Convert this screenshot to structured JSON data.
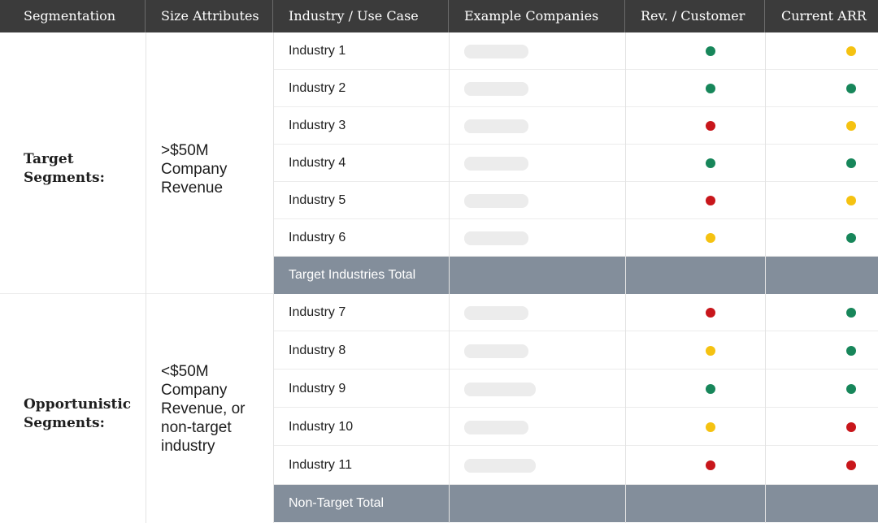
{
  "colors": {
    "green": "#17865a",
    "yellow": "#f5c211",
    "red": "#c8161b"
  },
  "headers": [
    "Segmentation",
    "Size Attributes",
    "Industry / Use Case",
    "Example Companies",
    "Rev. / Customer",
    "Current ARR"
  ],
  "groups": [
    {
      "segment": "Target Segments:",
      "size": ">$50M Company Revenue",
      "rows": [
        {
          "industry": "Industry 1",
          "rev": "green",
          "arr": "yellow"
        },
        {
          "industry": "Industry 2",
          "rev": "green",
          "arr": "green"
        },
        {
          "industry": "Industry 3",
          "rev": "red",
          "arr": "yellow"
        },
        {
          "industry": "Industry 4",
          "rev": "green",
          "arr": "green"
        },
        {
          "industry": "Industry 5",
          "rev": "red",
          "arr": "yellow"
        },
        {
          "industry": "Industry 6",
          "rev": "yellow",
          "arr": "green"
        }
      ],
      "total": "Target Industries Total"
    },
    {
      "segment": "Opportunistic Segments:",
      "size": "<$50M Company Revenue, or non-target industry",
      "rows": [
        {
          "industry": "Industry 7",
          "rev": "red",
          "arr": "green"
        },
        {
          "industry": "Industry 8",
          "rev": "yellow",
          "arr": "green"
        },
        {
          "industry": "Industry 9",
          "rev": "green",
          "arr": "green"
        },
        {
          "industry": "Industry 10",
          "rev": "yellow",
          "arr": "red"
        },
        {
          "industry": "Industry 11",
          "rev": "red",
          "arr": "red"
        }
      ],
      "total": "Non-Target Total"
    }
  ]
}
